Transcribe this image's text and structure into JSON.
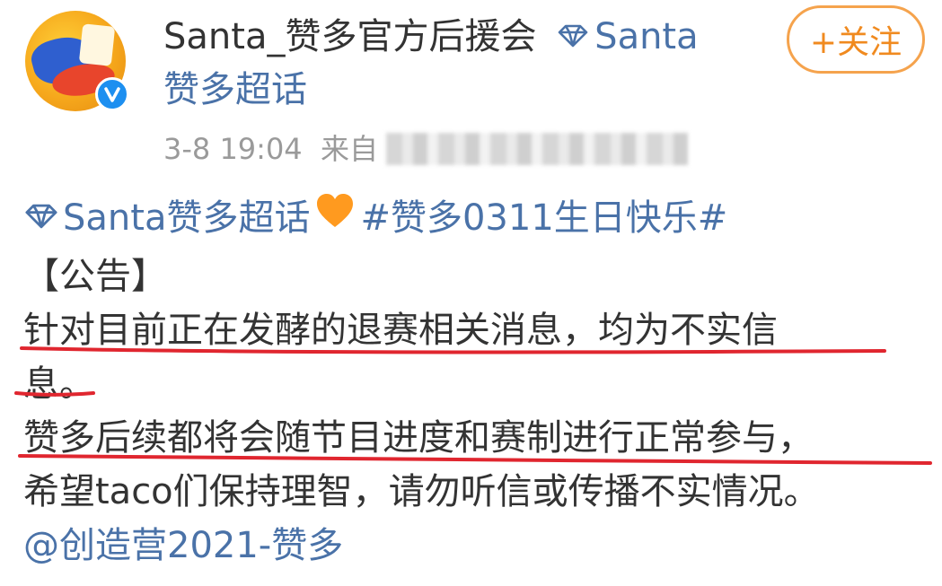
{
  "author": {
    "name": "Santa_赞多官方后援会",
    "tag": "Santa",
    "topic_line": "赞多超话",
    "avatar_icon": "avatar-image",
    "verify_icon": "verified-badge-icon"
  },
  "follow_button": {
    "label": "+关注"
  },
  "meta": {
    "time": "3-8 19:04",
    "source_prefix": "来自"
  },
  "post": {
    "supertopic": "Santa赞多超话",
    "hashtag": "#赞多0311生日快乐#",
    "heading": "【公告】",
    "line1": "针对目前正在发酵的退赛相关消息，均为不实信",
    "line2": "息。",
    "line3": " 赞多后续都将会随节目进度和赛制进行正常参与，",
    "line4": "希望taco们保持理智，请勿听信或传播不实情况。",
    "mention": "@创造营2021-赞多"
  },
  "colors": {
    "link": "#4a72a8",
    "follow_accent": "#f08a1f",
    "underline": "#e0262f",
    "heart": "#ff9a1f"
  }
}
